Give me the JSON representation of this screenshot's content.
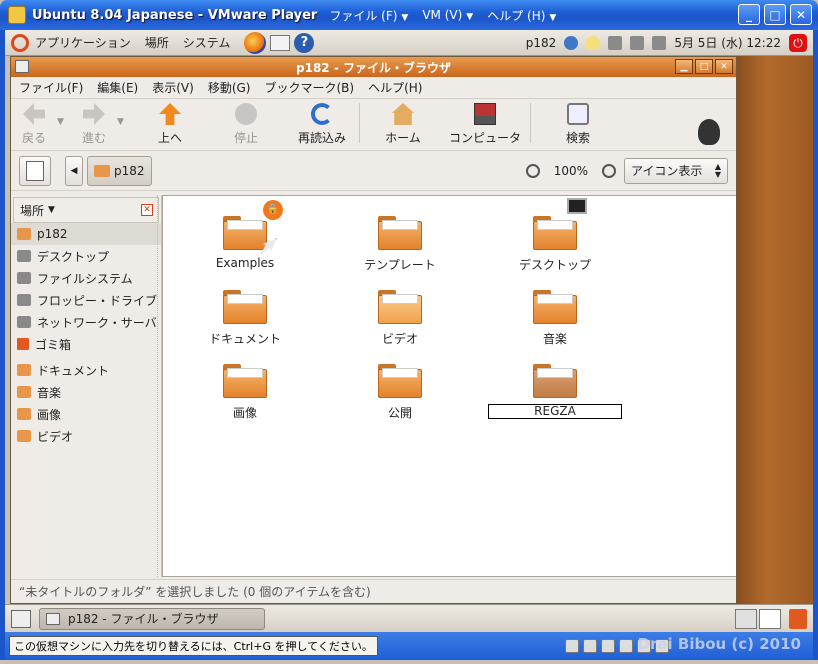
{
  "vmware": {
    "title": "Ubuntu 8.04 Japanese - VMware Player",
    "menus": [
      "ファイル (F)",
      "VM (V)",
      "ヘルプ (H)"
    ],
    "hint": "この仮想マシンに入力先を切り替えるには、Ctrl+G を押してください。",
    "watermark": "Drai Bibou (c) 2010"
  },
  "top_panel": {
    "menus": [
      "アプリケーション",
      "場所",
      "システム"
    ],
    "user": "p182",
    "clock": "5月 5日 (水) 12:22"
  },
  "window": {
    "title": "p182 - ファイル・ブラウザ",
    "menubar": [
      "ファイル(F)",
      "編集(E)",
      "表示(V)",
      "移動(G)",
      "ブックマーク(B)",
      "ヘルプ(H)"
    ],
    "toolbar": {
      "back": "戻る",
      "forward": "進む",
      "up": "上へ",
      "stop": "停止",
      "reload": "再読込み",
      "home": "ホーム",
      "computer": "コンピュータ",
      "search": "検索"
    },
    "location": {
      "path_button": "p182",
      "zoom": "100%",
      "view_mode": "アイコン表示"
    },
    "sidebar": {
      "header": "場所",
      "places": [
        {
          "label": "p182",
          "icon": "home-folder-icon"
        },
        {
          "label": "デスクトップ",
          "icon": "desktop-icon"
        },
        {
          "label": "ファイルシステム",
          "icon": "filesystem-icon"
        },
        {
          "label": "フロッピー・ドライブ",
          "icon": "floppy-icon"
        },
        {
          "label": "ネットワーク・サーバ",
          "icon": "network-icon"
        },
        {
          "label": "ゴミ箱",
          "icon": "trash-icon"
        }
      ],
      "bookmarks": [
        {
          "label": "ドキュメント"
        },
        {
          "label": "音楽"
        },
        {
          "label": "画像"
        },
        {
          "label": "ビデオ"
        }
      ]
    },
    "files": [
      {
        "name": "Examples"
      },
      {
        "name": "テンプレート"
      },
      {
        "name": "デスクトップ"
      },
      {
        "name": "ドキュメント"
      },
      {
        "name": "ビデオ"
      },
      {
        "name": "音楽"
      },
      {
        "name": "画像"
      },
      {
        "name": "公開"
      },
      {
        "name": "REGZA"
      }
    ],
    "status": "“未タイトルのフォルダ” を選択しました (0 個のアイテムを含む)"
  },
  "bottom_panel": {
    "task": "p182 - ファイル・ブラウザ"
  }
}
